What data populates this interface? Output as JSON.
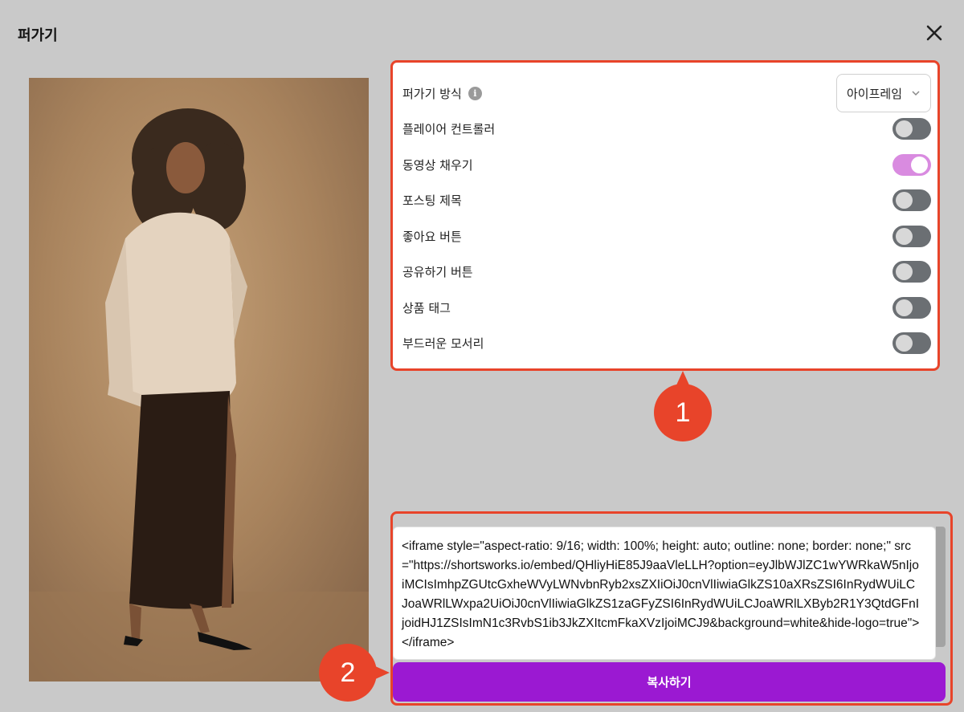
{
  "modal": {
    "title": "퍼가기"
  },
  "settings": {
    "method": {
      "label": "퍼가기 방식",
      "info_icon": "info-icon",
      "selected": "아이프레임"
    },
    "toggles": [
      {
        "label": "플레이어 컨트롤러",
        "on": false
      },
      {
        "label": "동영상 채우기",
        "on": true
      },
      {
        "label": "포스팅 제목",
        "on": false
      },
      {
        "label": "좋아요 버튼",
        "on": false
      },
      {
        "label": "공유하기 버튼",
        "on": false
      },
      {
        "label": "상품 태그",
        "on": false
      },
      {
        "label": "부드러운 모서리",
        "on": false
      }
    ]
  },
  "annotations": {
    "step1": "1",
    "step2": "2"
  },
  "embed": {
    "code": "<iframe style=\"aspect-ratio: 9/16; width: 100%; height: auto; outline: none; border: none;\" src=\"https://shortsworks.io/embed/QHliyHiE85J9aaVleLLH?option=eyJlbWJlZC1wYWRkaW5nIjoiMCIsImhpZGUtcGxheWVyLWNvbnRyb2xsZXIiOiJ0cnVlIiwiaGlkZS10aXRsZSI6InRydWUiLCJoaWRlLWxpa2UiOiJ0cnVlIiwiaGlkZS1zaGFyZSI6InRydWUiLCJoaWRlLXByb2R1Y3QtdGFnIjoidHJ1ZSIsImN1c3RvbS1ib3JkZXItcmFkaXVzIjoiMCJ9&background=white&hide-logo=true\"></iframe>",
    "copy_label": "복사하기"
  },
  "colors": {
    "accent": "#9b19d2",
    "toggle_on": "#d98be0",
    "toggle_off": "#6b6f73",
    "highlight": "#e8442a"
  }
}
